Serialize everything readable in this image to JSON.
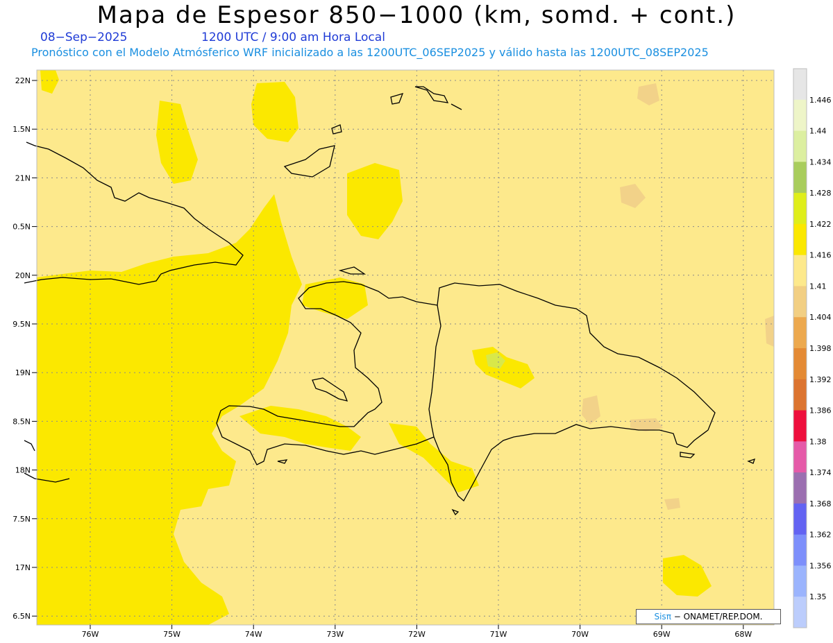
{
  "header": {
    "title": "Mapa de Espesor 850−1000 (km, somd. + cont.)",
    "date": "08−Sep−2025",
    "time": "1200 UTC / 9:00 am Hora Local",
    "subtitle": "Pronóstico con el Modelo Atmósferico WRF inicializado a las 1200UTC_06SEP2025 y válido hasta las  1200UTC_08SEP2025"
  },
  "map": {
    "lat_labels": [
      "22N",
      "1.5N",
      "21N",
      "0.5N",
      "20N",
      "9.5N",
      "19N",
      "8.5N",
      "18N",
      "7.5N",
      "17N",
      "6.5N"
    ],
    "lon_labels": [
      "76W",
      "75W",
      "74W",
      "73W",
      "72W",
      "71W",
      "70W",
      "69W",
      "68W"
    ],
    "colors": {
      "pale_yellow": "#fde98c",
      "bright_yellow": "#fbe800",
      "tan": "#f2d289",
      "light_green": "#d8e84a",
      "coastline": "#000000"
    }
  },
  "colorbar": {
    "labels": [
      "1.446",
      "1.44",
      "1.434",
      "1.428",
      "1.422",
      "1.416",
      "1.41",
      "1.404",
      "1.398",
      "1.392",
      "1.386",
      "1.38",
      "1.374",
      "1.368",
      "1.362",
      "1.356",
      "1.35"
    ],
    "colors": [
      "#e6e6e6",
      "#eef5c8",
      "#dcefa0",
      "#a9cd5c",
      "#dfee1a",
      "#fbe800",
      "#fde98c",
      "#f2cf83",
      "#eda94e",
      "#e48a34",
      "#dc7430",
      "#ee0f3c",
      "#e55aa8",
      "#9b6fb0",
      "#6363f2",
      "#7d8ffb",
      "#9bb4fd",
      "#bccdfc"
    ]
  },
  "credit": {
    "brand": "Sisπ",
    "text": " − ONAMET/REP.DOM."
  }
}
